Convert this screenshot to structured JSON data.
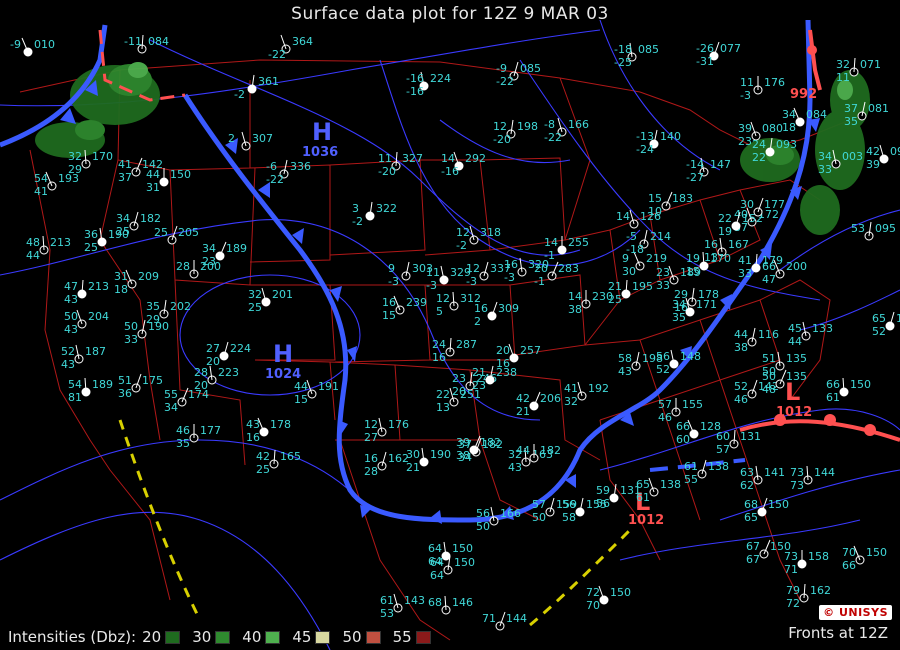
{
  "title": "Surface data plot for 12Z  9 MAR 03",
  "legend": {
    "label": "Intensities (Dbz):",
    "levels": [
      {
        "value": "20",
        "color": "#1f6b1f"
      },
      {
        "value": "30",
        "color": "#2f8a2f"
      },
      {
        "value": "40",
        "color": "#4fb04f"
      },
      {
        "value": "45",
        "color": "#d8d8a0"
      },
      {
        "value": "50",
        "color": "#c05040"
      },
      {
        "value": "55",
        "color": "#8b1a1a"
      }
    ]
  },
  "fronts_label": "Fronts at 12Z",
  "logo": "© UNISYS",
  "pressure_centers": [
    {
      "type": "H",
      "value": "1036",
      "color": "#5060ff"
    },
    {
      "type": "H",
      "value": "1024",
      "color": "#5060ff"
    },
    {
      "type": "L",
      "value": "1012",
      "color": "#ff5050"
    },
    {
      "type": "L",
      "value": "1012",
      "color": "#ff5050"
    },
    {
      "type": "L",
      "value": "992",
      "color": "#ff5050"
    }
  ],
  "stations": [
    {
      "t": "-9",
      "p": "010",
      "d": ""
    },
    {
      "t": "-11",
      "p": "084",
      "d": ""
    },
    {
      "t": "",
      "p": "364",
      "d": "-22"
    },
    {
      "t": "",
      "p": "361",
      "d": "-2"
    },
    {
      "t": "2",
      "p": "307",
      "d": ""
    },
    {
      "t": "-6",
      "p": "336",
      "d": "-22"
    },
    {
      "t": "-16",
      "p": "224",
      "d": "-16"
    },
    {
      "t": "-9",
      "p": "085",
      "d": "-22"
    },
    {
      "t": "-18",
      "p": "085",
      "d": "-25"
    },
    {
      "t": "-26",
      "p": "077",
      "d": "-31"
    },
    {
      "t": "32",
      "p": "170",
      "d": "29"
    },
    {
      "t": "41",
      "p": "142",
      "d": "37"
    },
    {
      "t": "44",
      "p": "150",
      "d": "31"
    },
    {
      "t": "54",
      "p": "193",
      "d": "41"
    },
    {
      "t": "11",
      "p": "327",
      "d": "-20"
    },
    {
      "t": "14",
      "p": "292",
      "d": "-16"
    },
    {
      "t": "12",
      "p": "198",
      "d": "-20"
    },
    {
      "t": "-8",
      "p": "166",
      "d": "-22"
    },
    {
      "t": "-13",
      "p": "140",
      "d": "-24"
    },
    {
      "t": "-14",
      "p": "147",
      "d": "-27"
    },
    {
      "t": "34",
      "p": "182",
      "d": "25"
    },
    {
      "t": "36",
      "p": "190",
      "d": "25"
    },
    {
      "t": "25",
      "p": "205",
      "d": ""
    },
    {
      "t": "48",
      "p": "213",
      "d": "44"
    },
    {
      "t": "34",
      "p": "189",
      "d": "23"
    },
    {
      "t": "28",
      "p": "200",
      "d": ""
    },
    {
      "t": "31",
      "p": "209",
      "d": "18"
    },
    {
      "t": "47",
      "p": "213",
      "d": "43"
    },
    {
      "t": "50",
      "p": "204",
      "d": "43"
    },
    {
      "t": "35",
      "p": "202",
      "d": "29"
    },
    {
      "t": "32",
      "p": "201",
      "d": "25"
    },
    {
      "t": "50",
      "p": "190",
      "d": "33"
    },
    {
      "t": "52",
      "p": "187",
      "d": "43"
    },
    {
      "t": "27",
      "p": "224",
      "d": "20"
    },
    {
      "t": "28",
      "p": "223",
      "d": "20"
    },
    {
      "t": "51",
      "p": "175",
      "d": "36"
    },
    {
      "t": "54",
      "p": "189",
      "d": "81"
    },
    {
      "t": "55",
      "p": "174",
      "d": "34"
    },
    {
      "t": "46",
      "p": "177",
      "d": "35"
    },
    {
      "t": "43",
      "p": "178",
      "d": "16"
    },
    {
      "t": "42",
      "p": "165",
      "d": "25"
    },
    {
      "t": "44",
      "p": "191",
      "d": "15"
    },
    {
      "t": "3",
      "p": "322",
      "d": "-2"
    },
    {
      "t": "12",
      "p": "318",
      "d": "-2"
    },
    {
      "t": "9",
      "p": "303",
      "d": "-3"
    },
    {
      "t": "11",
      "p": "329",
      "d": "-3"
    },
    {
      "t": "12",
      "p": "337",
      "d": "-3"
    },
    {
      "t": "16",
      "p": "320",
      "d": "-3"
    },
    {
      "t": "16",
      "p": "309",
      "d": "2"
    },
    {
      "t": "12",
      "p": "312",
      "d": "5"
    },
    {
      "t": "20",
      "p": "283",
      "d": "-1"
    },
    {
      "t": "14",
      "p": "255",
      "d": "-1"
    },
    {
      "t": "16",
      "p": "239",
      "d": "15"
    },
    {
      "t": "24",
      "p": "287",
      "d": "16"
    },
    {
      "t": "20",
      "p": "257",
      "d": "16"
    },
    {
      "t": "23",
      "p": "246",
      "d": "20"
    },
    {
      "t": "22",
      "p": "251",
      "d": "13"
    },
    {
      "t": "21",
      "p": "238",
      "d": "23"
    },
    {
      "t": "12",
      "p": "176",
      "d": "27"
    },
    {
      "t": "16",
      "p": "162",
      "d": "28"
    },
    {
      "t": "30",
      "p": "190",
      "d": "21"
    },
    {
      "t": "37",
      "p": "182",
      "d": "34"
    },
    {
      "t": "32",
      "p": "163",
      "d": "43"
    },
    {
      "t": "42",
      "p": "206",
      "d": "21"
    },
    {
      "t": "14",
      "p": "230",
      "d": "38"
    },
    {
      "t": "9",
      "p": "219",
      "d": "30"
    },
    {
      "t": "21",
      "p": "195",
      "d": "25"
    },
    {
      "t": "23",
      "p": "189",
      "d": "33"
    },
    {
      "t": "29",
      "p": "178",
      "d": "16"
    },
    {
      "t": "34",
      "p": "171",
      "d": "35"
    },
    {
      "t": "44",
      "p": "116",
      "d": "38"
    },
    {
      "t": "45",
      "p": "133",
      "d": "44"
    },
    {
      "t": "65",
      "p": "139",
      "d": "52"
    },
    {
      "t": "51",
      "p": "135",
      "d": "50"
    },
    {
      "t": "52",
      "p": "142",
      "d": "46"
    },
    {
      "t": "66",
      "p": "150",
      "d": "61"
    },
    {
      "t": "50",
      "p": "135",
      "d": "48"
    },
    {
      "t": "57",
      "p": "155",
      "d": "46"
    },
    {
      "t": "66",
      "p": "128",
      "d": "60"
    },
    {
      "t": "60",
      "p": "131",
      "d": "57"
    },
    {
      "t": "65",
      "p": "138",
      "d": "61"
    },
    {
      "t": "59",
      "p": "131",
      "d": "56"
    },
    {
      "t": "41",
      "p": "192",
      "d": "32"
    },
    {
      "t": "58",
      "p": "198",
      "d": "43"
    },
    {
      "t": "56",
      "p": "148",
      "d": "52"
    },
    {
      "t": "61",
      "p": "138",
      "d": "55"
    },
    {
      "t": "63",
      "p": "141",
      "d": "62"
    },
    {
      "t": "68",
      "p": "150",
      "d": "65"
    },
    {
      "t": "73",
      "p": "144",
      "d": "73"
    },
    {
      "t": "67",
      "p": "150",
      "d": "67"
    },
    {
      "t": "73",
      "p": "158",
      "d": "71"
    },
    {
      "t": "70",
      "p": "150",
      "d": "66"
    },
    {
      "t": "79",
      "p": "162",
      "d": "72"
    },
    {
      "t": "72",
      "p": "150",
      "d": "70"
    },
    {
      "t": "64",
      "p": "150",
      "d": "64"
    },
    {
      "t": "61",
      "p": "143",
      "d": "53"
    },
    {
      "t": "56",
      "p": "155",
      "d": "58"
    },
    {
      "t": "56",
      "p": "166",
      "d": "50"
    },
    {
      "t": "57",
      "p": "159",
      "d": "50"
    },
    {
      "t": "64",
      "p": "150",
      "d": "64"
    },
    {
      "t": "71",
      "p": "144",
      "d": ""
    },
    {
      "t": "68",
      "p": "146",
      "d": ""
    },
    {
      "t": "39",
      "p": "182",
      "d": "38"
    },
    {
      "t": "44",
      "p": "182",
      "d": ""
    },
    {
      "t": "66",
      "p": "200",
      "d": "47"
    },
    {
      "t": "41",
      "p": "179",
      "d": "33"
    },
    {
      "t": "40",
      "p": "172",
      "d": "37"
    },
    {
      "t": "53",
      "p": "095",
      "d": ""
    },
    {
      "t": "42",
      "p": "097",
      "d": "39"
    },
    {
      "t": "37",
      "p": "081",
      "d": "35"
    },
    {
      "t": "34",
      "p": "003",
      "d": "33"
    },
    {
      "t": "22",
      "p": "152",
      "d": "19"
    },
    {
      "t": "16",
      "p": "167",
      "d": "13"
    },
    {
      "t": "30",
      "p": "177",
      "d": ""
    },
    {
      "t": "19",
      "p": "170",
      "d": "15"
    },
    {
      "t": "15",
      "p": "183",
      "d": "10"
    },
    {
      "t": "11",
      "p": "176",
      "d": "-3"
    },
    {
      "t": "34",
      "p": "084",
      "d": "18"
    },
    {
      "t": "32",
      "p": "071",
      "d": "11"
    },
    {
      "t": "39",
      "p": "080",
      "d": "23"
    },
    {
      "t": "24",
      "p": "093",
      "d": "22"
    },
    {
      "t": "14",
      "p": "126",
      "d": ""
    },
    {
      "t": "-5",
      "p": "214",
      "d": "-18"
    },
    {
      "t": "-13",
      "p": "219",
      "d": "-22"
    }
  ]
}
